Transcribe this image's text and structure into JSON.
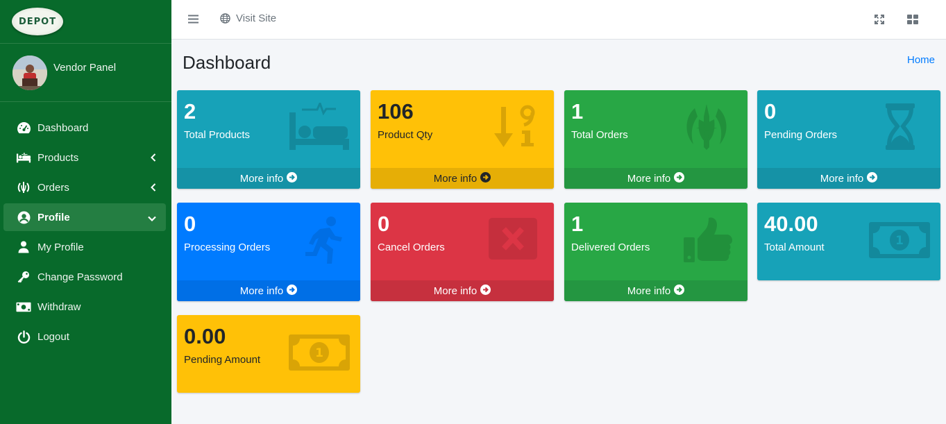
{
  "brand": {
    "logo_text": "DEPOT"
  },
  "user": {
    "name": "Vendor Panel"
  },
  "sidebar": {
    "items": [
      {
        "label": "Dashboard",
        "icon": "tachometer-icon"
      },
      {
        "label": "Products",
        "icon": "bed-icon"
      },
      {
        "label": "Orders",
        "icon": "orders-emblem-icon"
      },
      {
        "label": "Profile",
        "icon": "user-circle-icon"
      },
      {
        "label": "My Profile",
        "icon": "user-icon"
      },
      {
        "label": "Change Password",
        "icon": "key-icon"
      },
      {
        "label": "Withdraw",
        "icon": "money-bill-icon"
      },
      {
        "label": "Logout",
        "icon": "power-icon"
      }
    ]
  },
  "topbar": {
    "visit_site": "Visit Site"
  },
  "page": {
    "title": "Dashboard",
    "breadcrumb": "Home"
  },
  "boxes": [
    {
      "value": "2",
      "label": "Total Products",
      "footer": "More info"
    },
    {
      "value": "106",
      "label": "Product Qty",
      "footer": "More info"
    },
    {
      "value": "1",
      "label": "Total Orders",
      "footer": "More info"
    },
    {
      "value": "0",
      "label": "Pending Orders",
      "footer": "More info"
    },
    {
      "value": "0",
      "label": "Processing Orders",
      "footer": "More info"
    },
    {
      "value": "0",
      "label": "Cancel Orders",
      "footer": "More info"
    },
    {
      "value": "1",
      "label": "Delivered Orders",
      "footer": "More info"
    },
    {
      "value": "40.00",
      "label": "Total Amount"
    },
    {
      "value": "0.00",
      "label": "Pending Amount"
    }
  ],
  "colors": {
    "sidebar": "#086a2b",
    "info": "#17a2b8",
    "warning": "#ffc107",
    "success": "#28a745",
    "primary": "#007bff",
    "danger": "#dc3545",
    "link": "#007bff"
  }
}
